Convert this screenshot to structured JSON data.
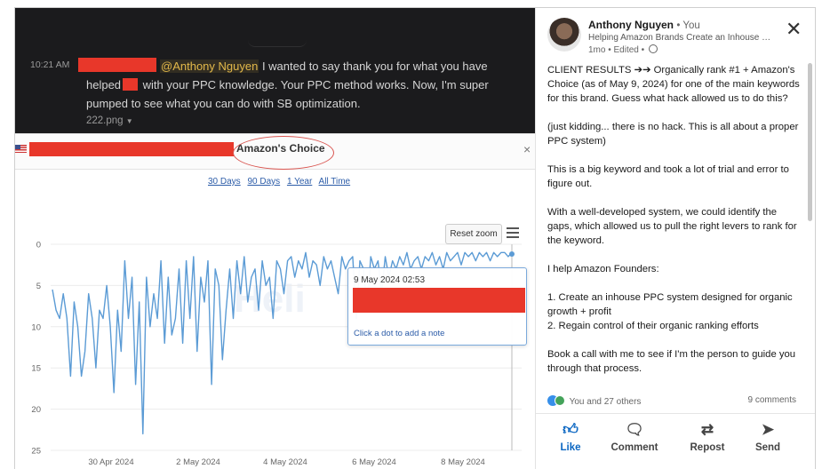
{
  "chat": {
    "time": "10:21 AM",
    "mention": "@Anthony Nguyen",
    "line1_rest": " I wanted to say thank you for what you have",
    "line2_start": "helped",
    "line2_rest": " with your PPC knowledge. Your PPC method works. Now, I'm super",
    "line3": "pumped to see what you can do with SB optimization.",
    "file": "222.png"
  },
  "shot": {
    "badge": "Amazon's Choice",
    "close": "×",
    "ranges": [
      "30 Days",
      "90 Days",
      "1 Year",
      "All Time"
    ],
    "reset_zoom": "Reset zoom",
    "tooltip": {
      "date": "9 May 2024 02:53",
      "note": "Click a dot to add a note"
    },
    "watermark": "Heli"
  },
  "chart_data": {
    "type": "line",
    "title": "",
    "xlabel": "",
    "ylabel": "",
    "y_reversed": true,
    "ylim": [
      0,
      25
    ],
    "yticks": [
      0,
      5,
      10,
      15,
      20,
      25
    ],
    "xticks": [
      "30 Apr 2024",
      "2 May 2024",
      "4 May 2024",
      "6 May 2024",
      "8 May 2024"
    ],
    "x_range": [
      "29 Apr 2024",
      "9 May 2024"
    ],
    "color": "#5b9bd5",
    "series": [
      {
        "values": [
          5.5,
          8,
          9,
          6,
          9,
          16,
          7,
          10,
          16,
          13,
          6,
          9,
          15,
          8,
          9,
          5,
          10,
          18,
          8,
          13,
          2,
          9,
          4,
          17,
          7,
          23,
          4,
          10,
          6,
          9,
          2,
          12,
          4,
          11,
          9,
          3,
          12,
          2,
          9,
          1.5,
          13,
          4,
          7,
          2,
          17,
          3,
          5,
          14,
          8,
          3,
          9,
          2,
          6,
          1.5,
          7,
          4,
          3,
          8,
          2,
          5,
          4,
          9,
          2,
          3,
          6,
          2,
          1.5,
          4,
          2,
          3,
          1,
          4,
          2,
          2.5,
          5,
          1.5,
          3,
          2,
          4,
          6,
          1.5,
          3,
          2,
          1.5,
          9,
          2,
          3,
          8,
          1.5,
          3,
          2,
          6,
          1.5,
          4,
          2,
          3,
          1.5,
          2.5,
          1,
          3,
          2,
          1.5,
          3,
          1.5,
          2,
          1,
          2.5,
          1.5,
          3,
          1,
          2,
          1.5,
          1,
          2.5,
          1,
          1.5,
          1,
          2,
          1,
          1.5,
          1,
          2,
          1,
          1.5,
          1,
          1,
          1.5,
          1
        ]
      }
    ]
  },
  "post": {
    "author": "Anthony Nguyen",
    "you": "• You",
    "headline": "Helping Amazon Brands Create an Inhouse PPC System",
    "meta": "1mo • Edited •",
    "close": "✕",
    "paragraphs": [
      "CLIENT RESULTS ➔➔ Organically rank #1 + Amazon's Choice (as of May 9, 2024) for one of the main keywords for this brand. Guess what hack allowed us to do this?",
      "(just kidding... there is no hack. This is all about a proper PPC system)",
      "This is a big keyword and took a lot of trial and error to figure out.",
      "With a well-developed system, we could identify the gaps, which allowed us to pull the right levers to rank for the keyword.",
      "I help Amazon Founders:",
      "1. Create an inhouse PPC system designed for organic growth + profit\n2. Regain control of their organic ranking efforts",
      "Book a call with me to see if I'm the person to guide you through that process."
    ],
    "reactions": "You and 27 others",
    "comments": "9 comments",
    "actions": {
      "like": "Like",
      "comment": "Comment",
      "repost": "Repost",
      "send": "Send"
    }
  }
}
